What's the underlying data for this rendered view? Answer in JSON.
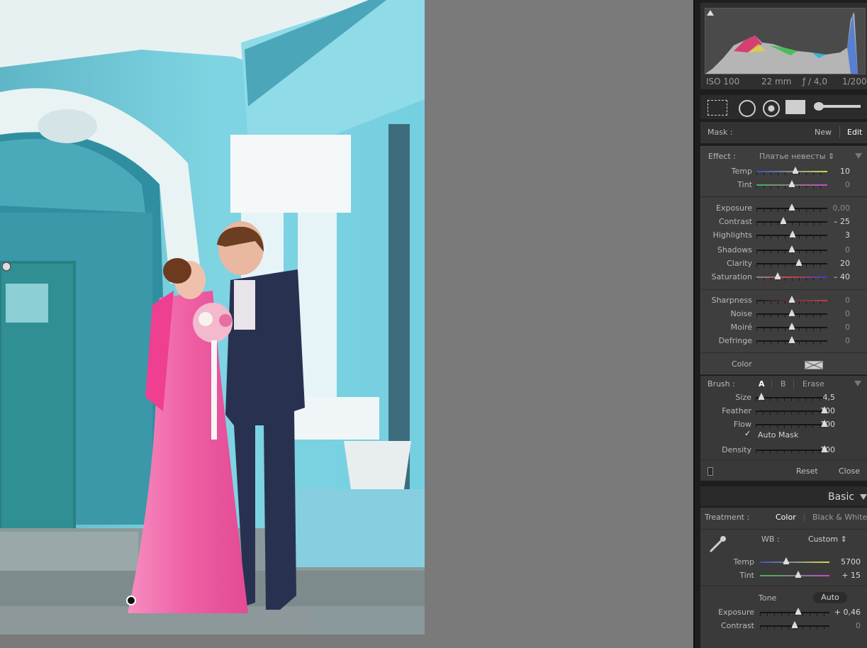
{
  "histogram": {
    "iso": "ISO 100",
    "focal": "22 mm",
    "aperture": "ƒ / 4,0",
    "shutter": "1/200"
  },
  "mask": {
    "label": "Mask :",
    "new_label": "New",
    "edit_label": "Edit"
  },
  "effect": {
    "label": "Effect :",
    "preset": "Платье невесты ⇕",
    "color_label": "Color",
    "sliders": [
      {
        "name": "Temp",
        "value": "10",
        "pos": 0.55,
        "gradient": "temp"
      },
      {
        "name": "Tint",
        "value": "0",
        "pos": 0.5,
        "gradient": "tint"
      },
      {
        "name": "Exposure",
        "value": "0,00",
        "pos": 0.5
      },
      {
        "name": "Contrast",
        "value": "– 25",
        "pos": 0.38
      },
      {
        "name": "Highlights",
        "value": "3",
        "pos": 0.51
      },
      {
        "name": "Shadows",
        "value": "0",
        "pos": 0.5
      },
      {
        "name": "Clarity",
        "value": "20",
        "pos": 0.6
      },
      {
        "name": "Saturation",
        "value": "– 40",
        "pos": 0.3,
        "gradient": "sat"
      },
      {
        "name": "Sharpness",
        "value": "0",
        "pos": 0.5,
        "gradient": "sharp"
      },
      {
        "name": "Noise",
        "value": "0",
        "pos": 0.5
      },
      {
        "name": "Moiré",
        "value": "0",
        "pos": 0.5
      },
      {
        "name": "Defringe",
        "value": "0",
        "pos": 0.5
      }
    ]
  },
  "brush": {
    "label": "Brush :",
    "a_label": "A",
    "b_label": "B",
    "erase_label": "Erase",
    "sliders": [
      {
        "name": "Size",
        "value": "4,5",
        "pos": 0.08
      },
      {
        "name": "Feather",
        "value": "100",
        "pos": 0.97
      },
      {
        "name": "Flow",
        "value": "100",
        "pos": 0.97
      },
      {
        "name": "Density",
        "value": "100",
        "pos": 0.97
      }
    ],
    "auto_mask_label": "Auto Mask",
    "auto_mask_checked": true,
    "reset_label": "Reset",
    "close_label": "Close"
  },
  "basic": {
    "title": "Basic",
    "treatment_label": "Treatment :",
    "color_label": "Color",
    "bw_label": "Black & White",
    "wb_label": "WB :",
    "wb_value": "Custom ⇕",
    "temp": {
      "name": "Temp",
      "value": "5700",
      "pos": 0.38
    },
    "tint": {
      "name": "Tint",
      "value": "+ 15",
      "pos": 0.55
    },
    "tone_label": "Tone",
    "auto_label": "Auto",
    "exposure": {
      "name": "Exposure",
      "value": "+ 0,46",
      "pos": 0.55
    },
    "contrast": {
      "name": "Contrast",
      "value": "0",
      "pos": 0.5
    }
  },
  "colors": {
    "panel_bg": "#3b3b3b",
    "dress": "#f06aa8",
    "wall": "#6fc9d8"
  }
}
